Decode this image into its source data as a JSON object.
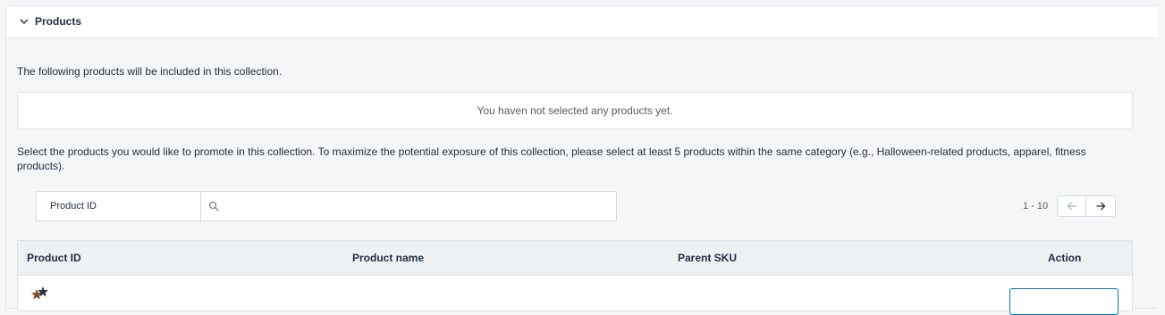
{
  "section": {
    "title": "Products",
    "intro": "The following products will be included in this collection.",
    "empty_message": "You haven not selected any products yet.",
    "instructions": "Select the products you would like to promote in this collection. To maximize the potential exposure of this collection, please select at least 5 products within the same category (e.g., Halloween-related products, apparel, fitness products)."
  },
  "search": {
    "field_selected": "Product ID",
    "placeholder": ""
  },
  "pagination": {
    "range": "1 - 10"
  },
  "table": {
    "columns": [
      "Product ID",
      "Product name",
      "Parent SKU",
      "Action"
    ]
  },
  "colors": {
    "accent": "#0073bb",
    "header_bg": "#eef1f4",
    "page_bg": "#f4f6f8"
  },
  "icons": [
    "chevron-down-icon",
    "search-icon",
    "arrow-left-icon",
    "arrow-right-icon"
  ]
}
